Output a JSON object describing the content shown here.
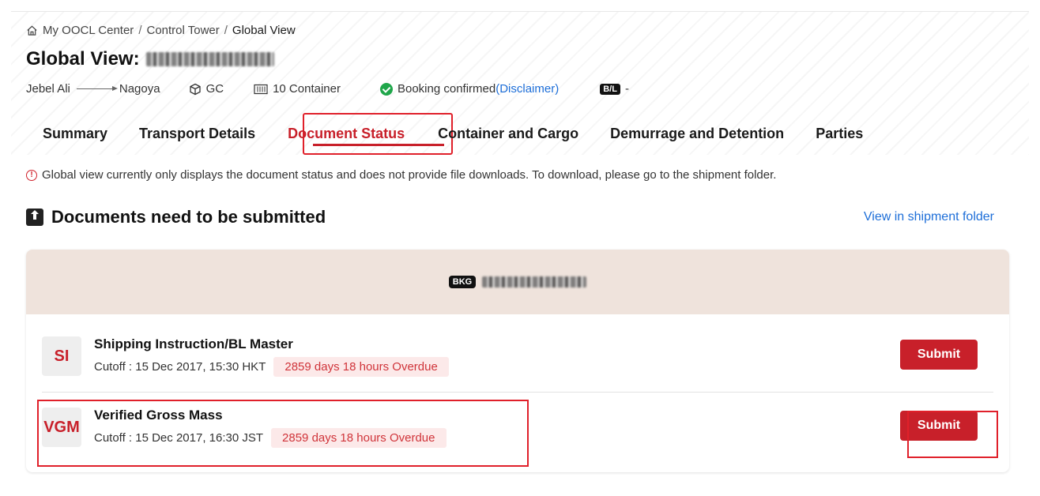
{
  "breadcrumb": {
    "items": [
      "My OOCL Center",
      "Control Tower",
      "Global View"
    ],
    "separator": "/"
  },
  "page_title": "Global View:",
  "meta": {
    "origin": "Jebel Ali",
    "destination": "Nagoya",
    "cargo_type": "GC",
    "containers": "10 Container",
    "status": "Booking confirmed",
    "disclaimer": "(Disclaimer)",
    "bl_badge": "B/L",
    "bl_value": "-"
  },
  "tabs": [
    {
      "label": "Summary",
      "active": false
    },
    {
      "label": "Transport Details",
      "active": false
    },
    {
      "label": "Document Status",
      "active": true
    },
    {
      "label": "Container and Cargo",
      "active": false
    },
    {
      "label": "Demurrage and Detention",
      "active": false
    },
    {
      "label": "Parties",
      "active": false
    }
  ],
  "notice": "Global view currently only displays the document status and does not provide file downloads. To download, please go to the shipment folder.",
  "section": {
    "title": "Documents need to be submitted",
    "view_link": "View in shipment folder"
  },
  "booking": {
    "badge": "BKG"
  },
  "documents": [
    {
      "code": "SI",
      "name": "Shipping Instruction/BL Master",
      "cutoff": "Cutoff : 15 Dec 2017, 15:30 HKT",
      "overdue": "2859 days 18 hours Overdue",
      "action": "Submit"
    },
    {
      "code": "VGM",
      "name": "Verified Gross Mass",
      "cutoff": "Cutoff : 15 Dec 2017, 16:30 JST",
      "overdue": "2859 days 18 hours Overdue",
      "action": "Submit"
    }
  ],
  "colors": {
    "brand_red": "#c8202a",
    "link_blue": "#1d6ed8",
    "confirmed_green": "#1fa64a",
    "booking_bg": "#efe3dc",
    "overdue_bg": "#fce9e9"
  }
}
